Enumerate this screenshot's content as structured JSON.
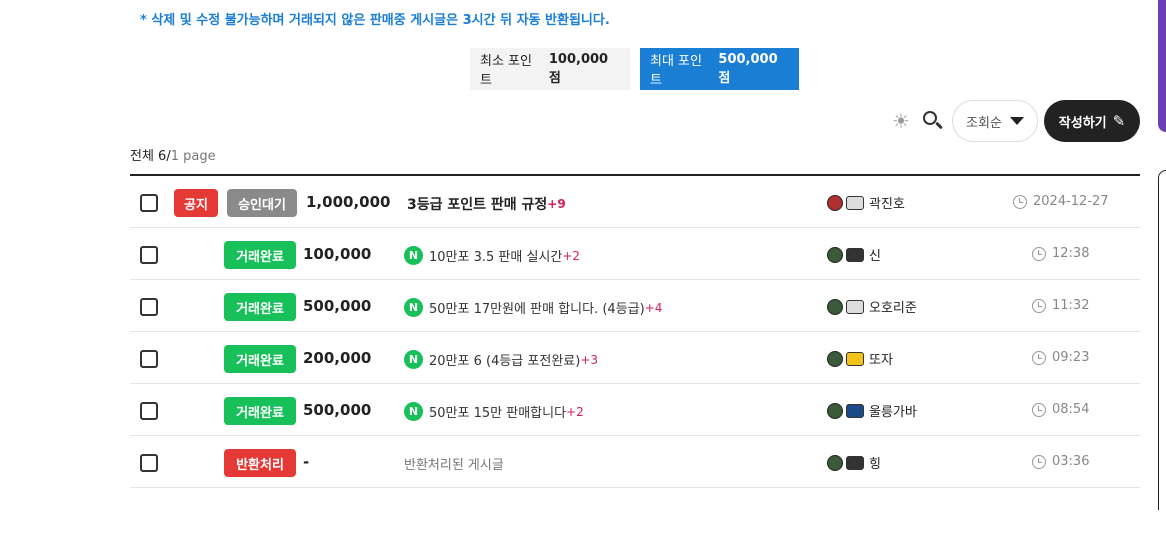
{
  "notice": "* 삭제 및 수정 불가능하며 거래되지 않은 판매중 게시글은 3시간 뒤 자동 반환됩니다.",
  "point_range": {
    "min_label": "최소 포인트",
    "min_value": "100,000점",
    "max_label": "최대 포인트",
    "max_value": "500,000점"
  },
  "toolbar": {
    "sort_label": "조회순",
    "write_label": "작성하기"
  },
  "summary": {
    "total": "전체 6/",
    "page": "1 page"
  },
  "rows": [
    {
      "badge1": "공지",
      "badge2": "승인대기",
      "price": "1,000,000",
      "title": "3등급 포인트 판매 규정",
      "comments": "+9",
      "author": "곽진호",
      "date": "2024-12-27"
    },
    {
      "badge": "거래완료",
      "price": "100,000",
      "title": "10만포 3.5 판매 실시간",
      "comments": "+2",
      "author": "신",
      "date": "12:38"
    },
    {
      "badge": "거래완료",
      "price": "500,000",
      "title": "50만포 17만원에 판매 합니다. (4등급)",
      "comments": "+4",
      "author": "오호리준",
      "date": "11:32"
    },
    {
      "badge": "거래완료",
      "price": "200,000",
      "title": "20만포 6 (4등급 포전완료)",
      "comments": "+3",
      "author": "또자",
      "date": "09:23"
    },
    {
      "badge": "거래완료",
      "price": "500,000",
      "title": "50만포 15만 판매합니다",
      "comments": "+2",
      "author": "울릉가바",
      "date": "08:54"
    },
    {
      "badge": "반환처리",
      "price": "-",
      "title": "반환처리된 게시글",
      "author": "힝",
      "date": "03:36"
    }
  ],
  "icons": {
    "new": "N",
    "sun": "☀",
    "pencil": "✎"
  },
  "colors": {
    "accent_blue": "#1a7fd4",
    "done_green": "#18c05a",
    "notice_red": "#e53935",
    "comment_pink": "#d81b60"
  }
}
